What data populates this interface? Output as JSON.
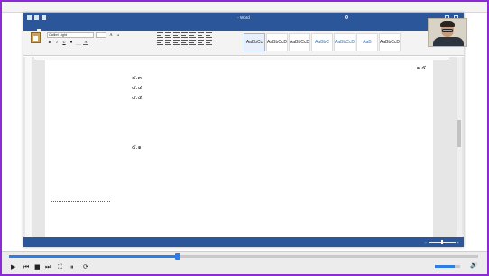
{
  "player": {
    "menu": [
      "",
      "",
      "",
      "",
      ""
    ],
    "progress_fraction": 0.36,
    "volume_fraction": 0.8,
    "time_current": "",
    "time_total": "",
    "buttons": {
      "play": "▶",
      "stop": "■",
      "prev": "⏮",
      "next": "⏭",
      "frame": "⏸",
      "loop": "⟳",
      "fullscreen": "⛶"
    }
  },
  "word": {
    "title": "",
    "app": "Word",
    "ribbon_tabs": [
      "",
      "",
      "",
      "",
      "",
      "",
      "",
      "",
      ""
    ],
    "active_tab_index": 1,
    "search_placeholder": "",
    "clipboard_label": "",
    "font_name": "Calibri Light",
    "font_size": "",
    "font_buttons": [
      "B",
      "I",
      "U"
    ],
    "styles": [
      {
        "sample": "AaBbCc",
        "name": "",
        "heading": false,
        "selected": true
      },
      {
        "sample": "AaBbCcD",
        "name": "",
        "heading": false,
        "selected": false
      },
      {
        "sample": "AaBbCcD",
        "name": "",
        "heading": false,
        "selected": false
      },
      {
        "sample": "AaBbC",
        "name": "",
        "heading": true,
        "selected": false
      },
      {
        "sample": "AaBbCcD",
        "name": "",
        "heading": true,
        "selected": false
      },
      {
        "sample": "AaB",
        "name": "",
        "heading": true,
        "selected": false
      },
      {
        "sample": "AaBbCcD",
        "name": "",
        "heading": false,
        "selected": false
      }
    ],
    "status": {
      "page": "",
      "words": "",
      "language": ""
    },
    "colors": {
      "accent": "#2b579a",
      "red_text": "#c0392b",
      "frame_border": "#8a2bd6",
      "seek_blue": "#2f7de1"
    }
  },
  "document": {
    "lines": [
      {
        "time": "",
        "text": "",
        "style": "plain",
        "indent": 2
      },
      {
        "time": "",
        "text": "๔.๓",
        "style": "plain",
        "indent": 2
      },
      {
        "time": "",
        "text": "๔.๔",
        "style": "plain",
        "indent": 2
      },
      {
        "time": "",
        "text": "๔.๕",
        "style": "plain",
        "indent": 2
      },
      {
        "time": "",
        "text": "",
        "style": "red",
        "indent": 2
      },
      {
        "time": "",
        "text": "",
        "style": "red",
        "indent": 2
      },
      {
        "time": "",
        "text": "",
        "style": "plain",
        "indent": 1
      },
      {
        "time": "",
        "text": "",
        "style": "bold",
        "indent": 1
      },
      {
        "time": "",
        "text": "๕.๑",
        "style": "plain",
        "indent": 2
      },
      {
        "time": "",
        "text": "",
        "style": "red",
        "indent": 2
      },
      {
        "time": "",
        "text": "",
        "style": "red",
        "indent": 2
      },
      {
        "time": "",
        "text": "",
        "style": "bold",
        "indent": 1
      },
      {
        "time": "",
        "text": "",
        "style": "red",
        "indent": 1
      },
      {
        "time": "",
        "text": "",
        "style": "underline-red",
        "indent": 1
      },
      {
        "time": "",
        "text": "",
        "style": "bold",
        "indent": 0
      },
      {
        "time": "",
        "text": "",
        "style": "bold",
        "indent": 1
      }
    ],
    "spacing_control": "๑.๕"
  },
  "webcam": {
    "name": ""
  }
}
